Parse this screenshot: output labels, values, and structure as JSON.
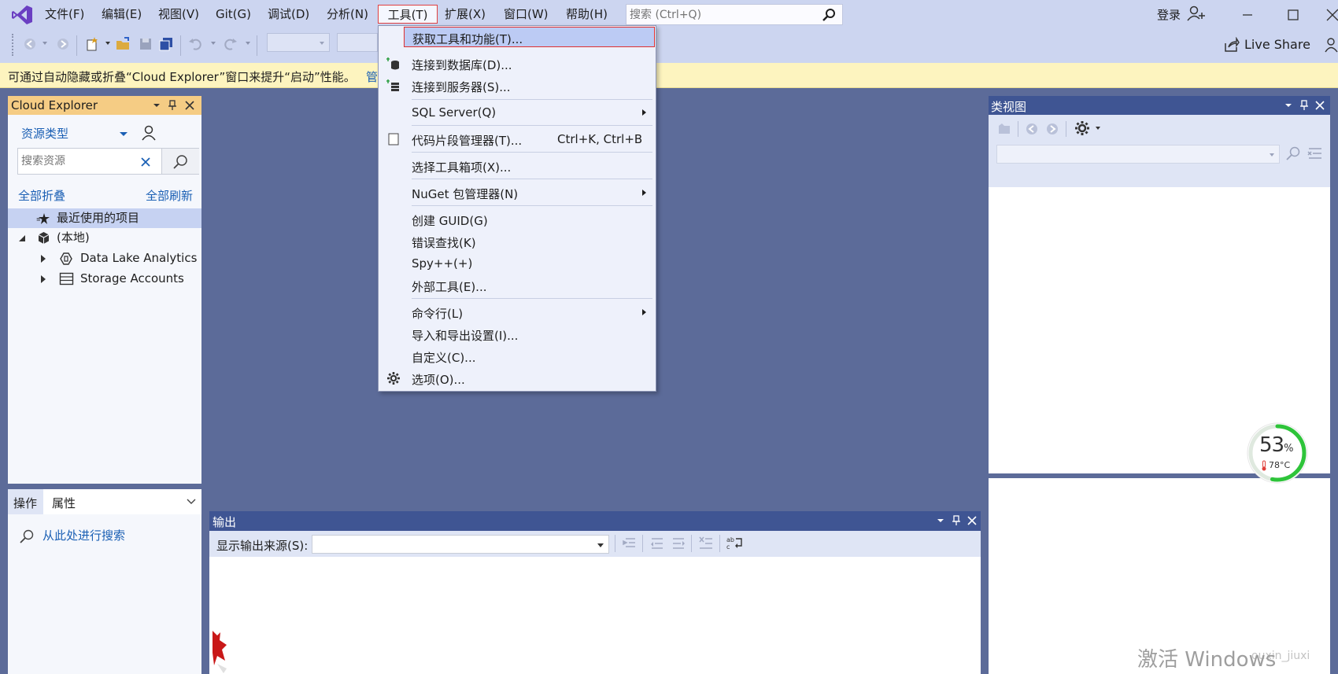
{
  "menubar": {
    "items": [
      "文件(F)",
      "编辑(E)",
      "视图(V)",
      "Git(G)",
      "调试(D)",
      "分析(N)",
      "工具(T)",
      "扩展(X)",
      "窗口(W)",
      "帮助(H)"
    ],
    "active_item": "工具(T)",
    "search_placeholder": "搜索 (Ctrl+Q)",
    "signin_label": "登录"
  },
  "toolbar": {
    "liveshare_label": "Live Share"
  },
  "infobar": {
    "message": "可通过自动隐藏或折叠“Cloud Explorer”窗口来提升“启动”性能。",
    "link_fragment": "管"
  },
  "cloud_explorer": {
    "title": "Cloud Explorer",
    "resource_type_label": "资源类型",
    "search_placeholder": "搜索资源",
    "collapse_all_label": "全部折叠",
    "refresh_all_label": "全部刷新",
    "tree": {
      "recent_label": "最近使用的项目",
      "local_label": "(本地)",
      "data_lake_label": "Data Lake Analytics",
      "storage_label": "Storage Accounts"
    }
  },
  "bottom_left_panel": {
    "tab_actions": "操作",
    "tab_properties": "属性",
    "search_link": "从此处进行搜索"
  },
  "class_view": {
    "title": "类视图"
  },
  "output": {
    "title": "输出",
    "source_label": "显示输出来源(S):"
  },
  "tools_menu": {
    "items": [
      {
        "label": "获取工具和功能(T)...",
        "highlighted": true
      },
      {
        "label": "连接到数据库(D)...",
        "icon": "database-connect-icon"
      },
      {
        "label": "连接到服务器(S)...",
        "icon": "server-connect-icon"
      },
      {
        "label": "SQL Server(Q)",
        "submenu": true
      },
      {
        "label": "代码片段管理器(T)...",
        "shortcut": "Ctrl+K, Ctrl+B",
        "icon": "checkbox-icon"
      },
      {
        "label": "选择工具箱项(X)..."
      },
      {
        "label": "NuGet 包管理器(N)",
        "submenu": true
      },
      {
        "label": "创建 GUID(G)"
      },
      {
        "label": "错误查找(K)"
      },
      {
        "label": "Spy++(+)"
      },
      {
        "label": "外部工具(E)..."
      },
      {
        "label": "命令行(L)",
        "submenu": true
      },
      {
        "label": "导入和导出设置(I)..."
      },
      {
        "label": "自定义(C)..."
      },
      {
        "label": "选项(O)...",
        "icon": "gear-icon"
      }
    ]
  },
  "system_widget": {
    "usage_percent": 53,
    "percent_sign": "%",
    "temperature": "78°C"
  },
  "watermark": {
    "text": "激活 Windows",
    "overlay_text": "ouxin_jiuxi"
  },
  "colors": {
    "accent_blue": "#3f5593",
    "menu_highlight": "#bccbf4",
    "highlight_border": "#e03030",
    "gauge_green": "#2ec43a"
  }
}
